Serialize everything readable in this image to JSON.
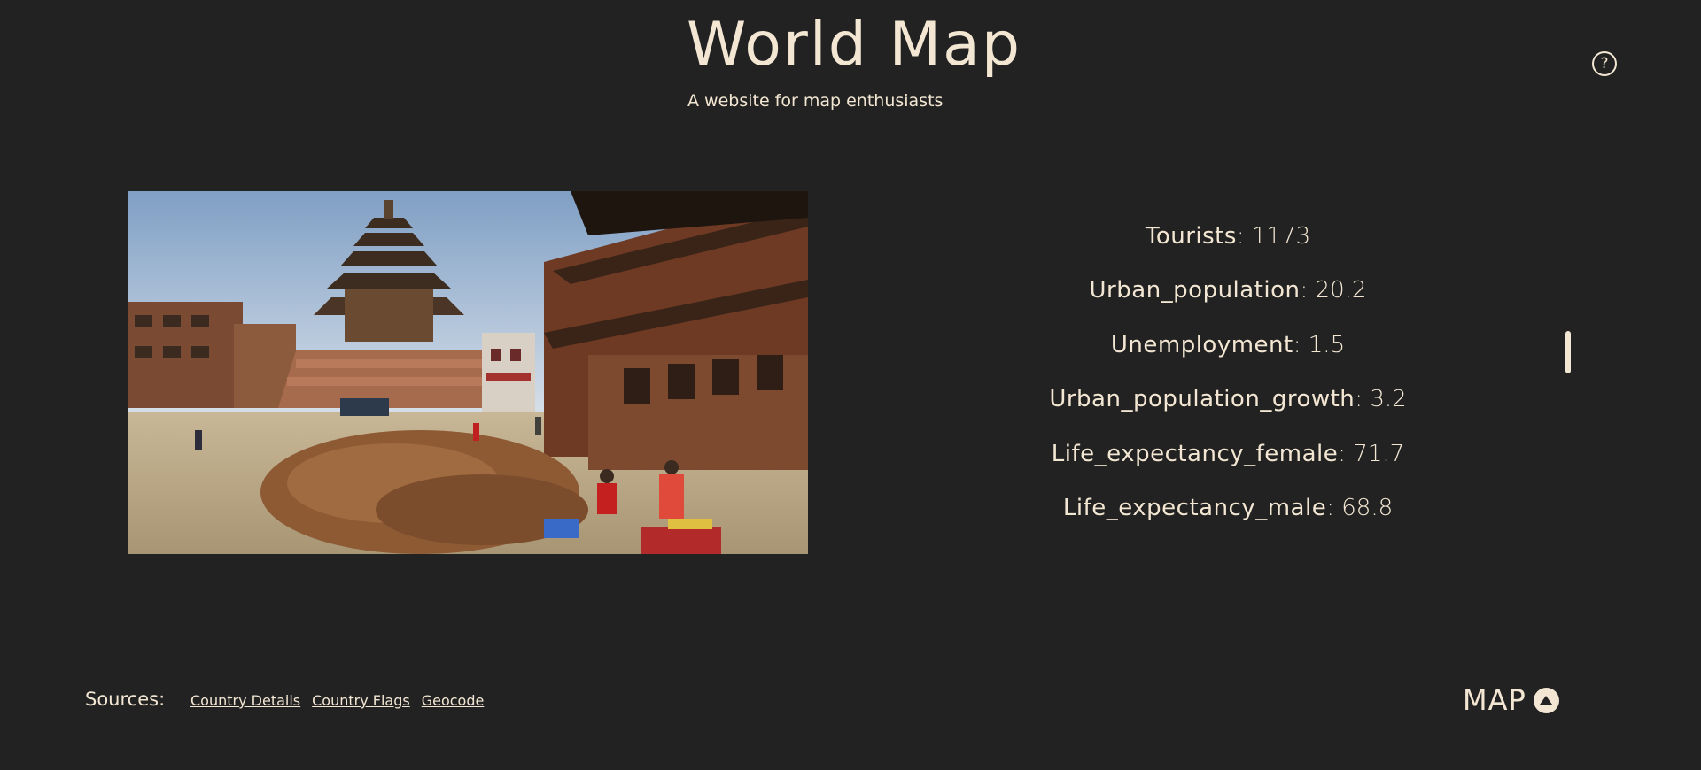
{
  "header": {
    "title": "World Map",
    "subtitle": "A website for map enthusiasts",
    "help_icon": "?"
  },
  "photo": {
    "icon": "country-photo"
  },
  "stats": [
    {
      "key": "Tourists",
      "value": ": 1173"
    },
    {
      "key": "Urban_population",
      "value": ": 20.2"
    },
    {
      "key": "Unemployment",
      "value": ": 1.5"
    },
    {
      "key": "Urban_population_growth",
      "value": ": 3.2"
    },
    {
      "key": "Life_expectancy_female",
      "value": ": 71.7"
    },
    {
      "key": "Life_expectancy_male",
      "value": ": 68.8"
    }
  ],
  "footer": {
    "sources_label": "Sources:",
    "links": [
      "Country Details",
      "Country Flags",
      "Geocode"
    ],
    "map_label": "MAP"
  },
  "colors": {
    "background": "#222222",
    "text": "#f3e7d3"
  }
}
